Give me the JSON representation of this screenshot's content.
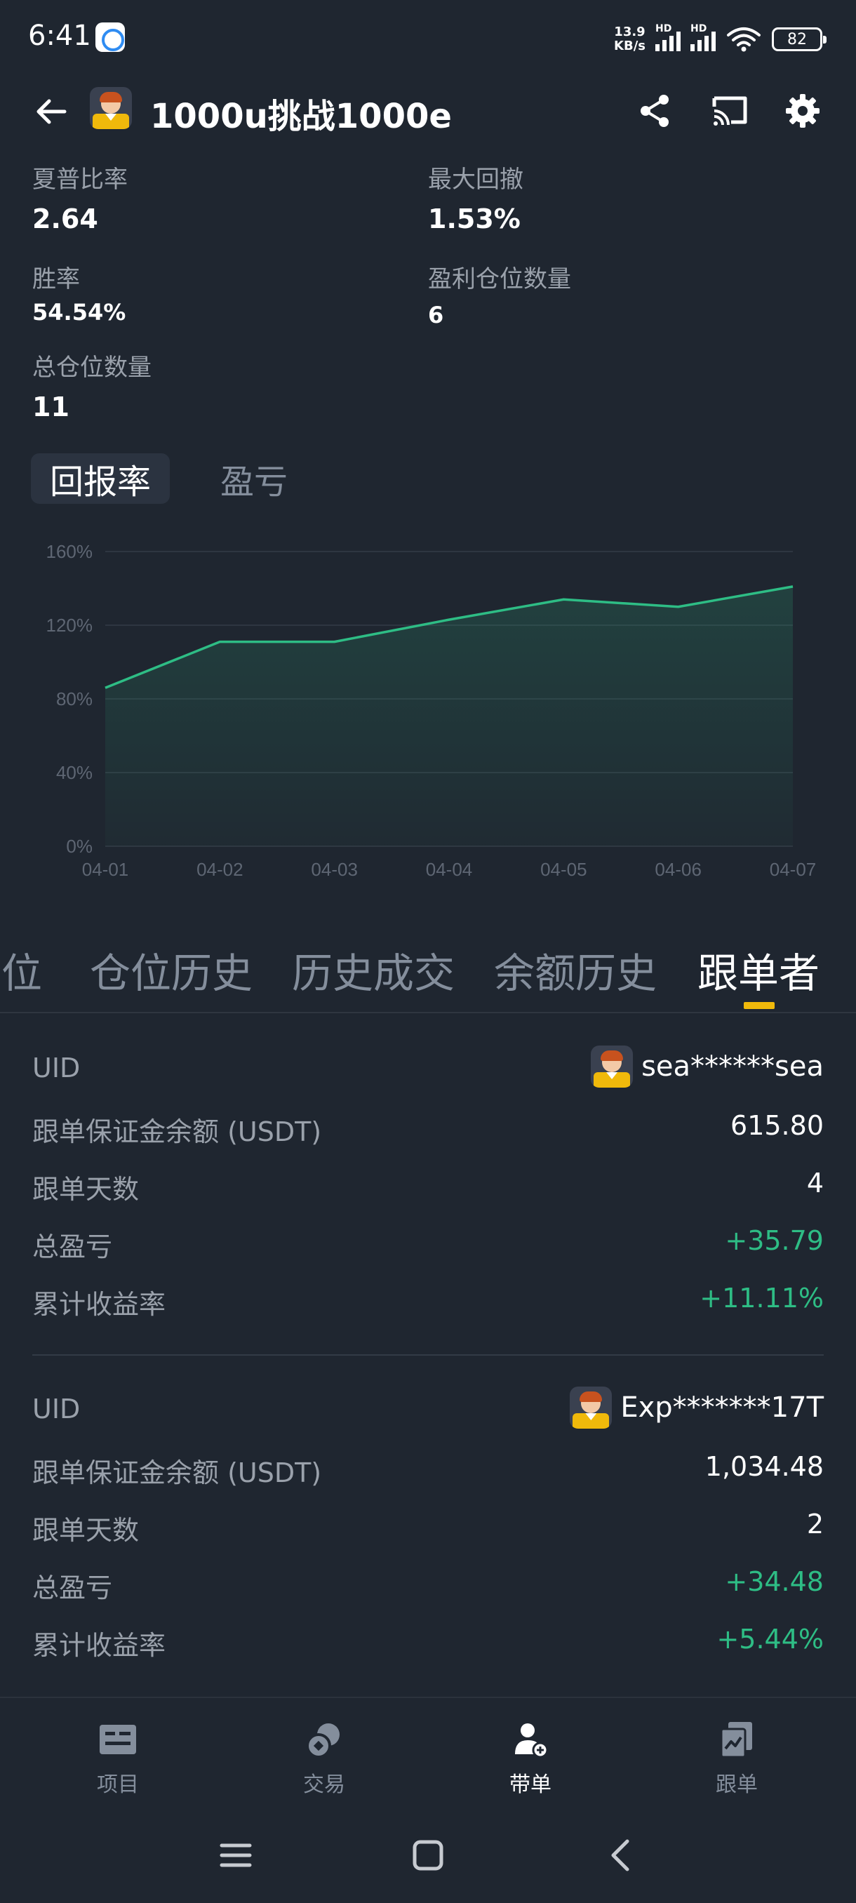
{
  "status_bar": {
    "time": "6:41",
    "net_speed_value": "13.9",
    "net_speed_unit": "KB/s",
    "hd_1": "HD",
    "hd_2": "HD",
    "battery": "82"
  },
  "header": {
    "title": "1000u挑战1000e",
    "icons": [
      "back-arrow-icon",
      "share-icon",
      "cast-icon",
      "gear-icon"
    ]
  },
  "stats": {
    "sharpe_label": "夏普比率",
    "sharpe_value": "2.64",
    "max_drawdown_label": "最大回撤",
    "max_drawdown_value": "1.53%",
    "win_rate_label": "胜率",
    "win_rate_value": "54.54%",
    "profit_positions_label": "盈利仓位数量",
    "profit_positions_value": "6",
    "total_positions_label": "总仓位数量",
    "total_positions_value": "11"
  },
  "chart_tabs": {
    "return_rate": "回报率",
    "pnl": "盈亏"
  },
  "chart_data": {
    "type": "area",
    "title": "",
    "xlabel": "",
    "ylabel": "",
    "categories": [
      "04-01",
      "04-02",
      "04-03",
      "04-04",
      "04-05",
      "04-06",
      "04-07"
    ],
    "series": [
      {
        "values": [
          86,
          111,
          111,
          123,
          134,
          130,
          141
        ]
      }
    ],
    "y_ticks": [
      "0%",
      "40%",
      "80%",
      "120%",
      "160%"
    ],
    "ylim": [
      0,
      160
    ],
    "grid": true,
    "line_color": "#2ebd85"
  },
  "section_tabs": {
    "positions_partial": "仓位",
    "position_history": "仓位历史",
    "trade_history": "历史成交",
    "balance_history": "余额历史",
    "followers": "跟单者"
  },
  "followers": [
    {
      "uid_label": "UID",
      "uid_value": "sea******sea",
      "margin_label": "跟单保证金余额 (USDT)",
      "margin_value": "615.80",
      "days_label": "跟单天数",
      "days_value": "4",
      "pnl_label": "总盈亏",
      "pnl_value": "+35.79",
      "roi_label": "累计收益率",
      "roi_value": "+11.11%"
    },
    {
      "uid_label": "UID",
      "uid_value": "Exp*******17T",
      "margin_label": "跟单保证金余额 (USDT)",
      "margin_value": "1,034.48",
      "days_label": "跟单天数",
      "days_value": "2",
      "pnl_label": "总盈亏",
      "pnl_value": "+34.48",
      "roi_label": "累计收益率",
      "roi_value": "+5.44%"
    }
  ],
  "bottom_nav": [
    {
      "label": "项目",
      "icon": "projects-icon"
    },
    {
      "label": "交易",
      "icon": "trade-icon"
    },
    {
      "label": "带单",
      "icon": "lead-trading-icon"
    },
    {
      "label": "跟单",
      "icon": "copy-trading-icon"
    }
  ],
  "colors": {
    "background": "#1f2630",
    "accent": "#f0b90b",
    "positive": "#2ebd85",
    "muted_text": "#848e9c"
  }
}
